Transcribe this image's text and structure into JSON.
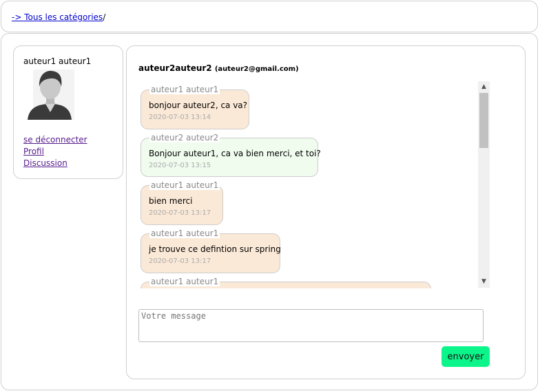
{
  "breadcrumb": {
    "link": "-> Tous les catégories",
    "separator": "/"
  },
  "sidebar": {
    "user_name": "auteur1 auteur1",
    "links": [
      "se déconnecter",
      "Profil",
      "Discussion"
    ]
  },
  "chat": {
    "header_name": "auteur2auteur2",
    "header_email": "(auteur2@gmail.com)",
    "messages": [
      {
        "author": "auteur1 auteur1",
        "text": "bonjour auteur2, ca va?",
        "time": "2020-07-03 13:14"
      },
      {
        "author": "auteur2 auteur2",
        "text": "Bonjour auteur1, ca va bien merci, et toi?",
        "time": "2020-07-03 13:15"
      },
      {
        "author": "auteur1 auteur1",
        "text": "bien merci",
        "time": "2020-07-03 13:17"
      },
      {
        "author": "auteur1 auteur1",
        "text": "je trouve ce defintion sur spring",
        "time": "2020-07-03 13:17"
      },
      {
        "author": "auteur1 auteur1"
      }
    ],
    "input_placeholder": "Votre message",
    "send_label": "envoyer"
  },
  "colors": {
    "mine_bubble": "#fbe9d7",
    "theirs_bubble": "#effcee",
    "send_button": "#0cf58a"
  },
  "icons": {
    "avatar": "user-avatar-icon",
    "scroll_up": "chevron-up-icon",
    "scroll_down": "chevron-down-icon"
  }
}
